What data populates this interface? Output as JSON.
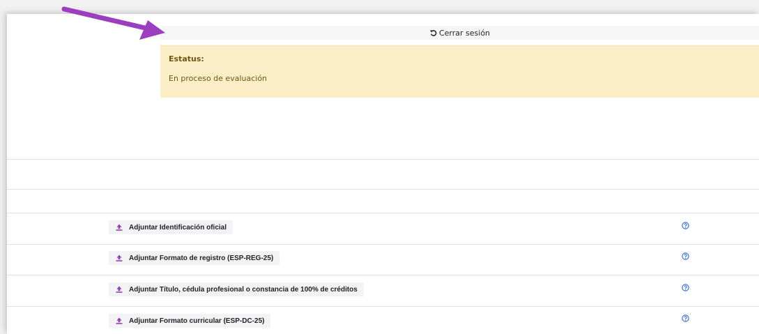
{
  "header": {
    "logout_label": "Cerrar sesión"
  },
  "status": {
    "title": "Estatus:",
    "value": "En proceso de evaluación"
  },
  "documents": [
    {
      "label": "Adjuntar Identificación oficial"
    },
    {
      "label": "Adjuntar Formato de registro (ESP-REG-25)"
    },
    {
      "label": "Adjuntar Título, cédula profesional o constancia de 100% de créditos"
    },
    {
      "label": "Adjuntar Formato curricular (ESP-DC-25)"
    }
  ],
  "icons": {
    "logout": "undo-arrow-icon",
    "upload": "upload-icon",
    "help": "question-circle-icon",
    "annotation": "arrow-icon"
  },
  "colors": {
    "status_background": "#fcefc8",
    "status_text": "#6e5410",
    "accent": "#8e44ad",
    "help_icon": "#3b6fd1"
  }
}
